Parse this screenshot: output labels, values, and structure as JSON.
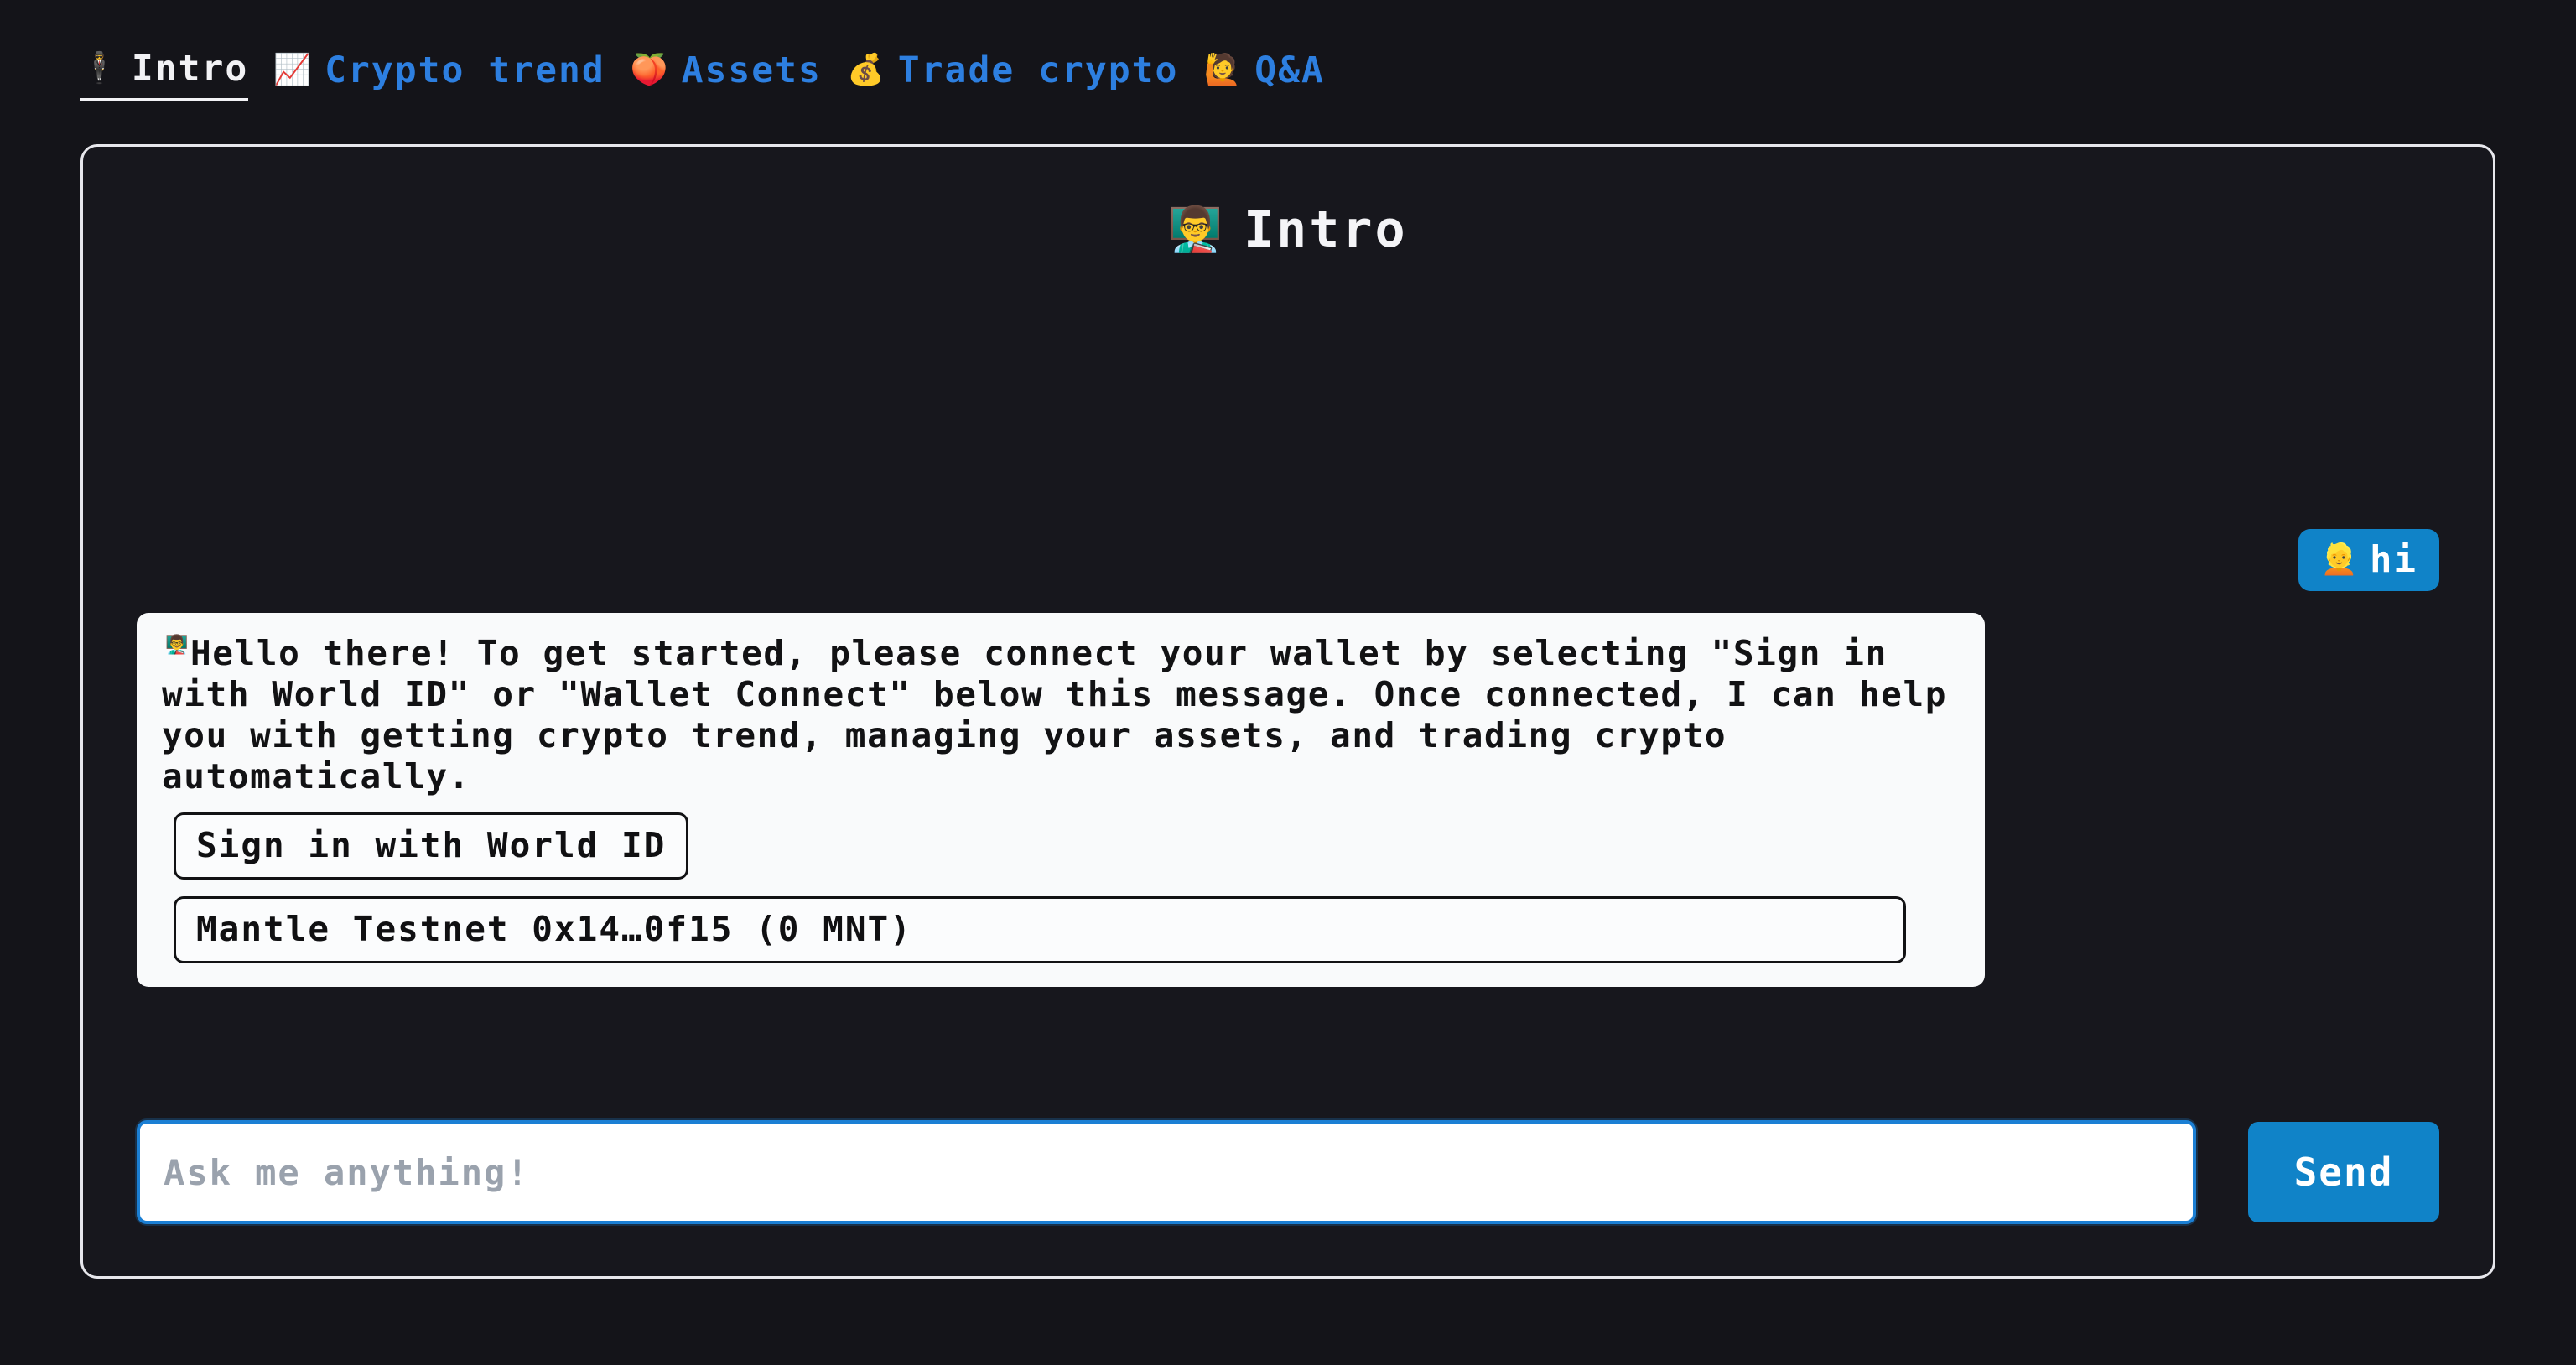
{
  "theme": {
    "background": "#141419",
    "card_border": "#e7e7ec",
    "accent_blue": "#2d7fe0",
    "bubble_blue": "#1083c8",
    "bubble_light": "#f9fafb",
    "active_nav": "#f2f2f5",
    "input_border": "#1b7fd4",
    "placeholder": "#9aa2ad"
  },
  "nav": {
    "items": [
      {
        "emoji": "🕴️",
        "icon_name": "person-in-suit-icon",
        "label": "Intro",
        "active": true
      },
      {
        "emoji": "📈",
        "icon_name": "chart-increasing-icon",
        "label": "Crypto trend",
        "active": false
      },
      {
        "emoji": "🍑",
        "icon_name": "peach-icon",
        "label": "Assets",
        "active": false
      },
      {
        "emoji": "💰",
        "icon_name": "money-bag-icon",
        "label": "Trade crypto",
        "active": false
      },
      {
        "emoji": "🙋",
        "icon_name": "person-raising-hand-icon",
        "label": "Q&A",
        "active": false
      }
    ]
  },
  "card": {
    "title": {
      "emoji": "👨‍🏫",
      "icon_name": "teacher-icon",
      "text": "Intro"
    }
  },
  "chat": {
    "user_message": {
      "emoji": "👱",
      "icon_name": "blond-person-icon",
      "text": "hi"
    },
    "bot_message": {
      "emoji": "👨‍🏫",
      "icon_name": "teacher-icon",
      "text": "Hello there! To get started, please connect your wallet by selecting \"Sign in with World ID\" or \"Wallet Connect\" below this message. Once connected, I can help you with getting crypto trend, managing your assets, and trading crypto automatically.",
      "actions": [
        {
          "label": "Sign in with World ID",
          "name": "sign-in-world-id-button",
          "block": false
        },
        {
          "label": "Mantle Testnet 0x14…0f15 (0 MNT)",
          "name": "wallet-connect-button",
          "block": true
        }
      ]
    }
  },
  "composer": {
    "input_value": "",
    "placeholder": "Ask me anything!",
    "send_label": "Send"
  }
}
